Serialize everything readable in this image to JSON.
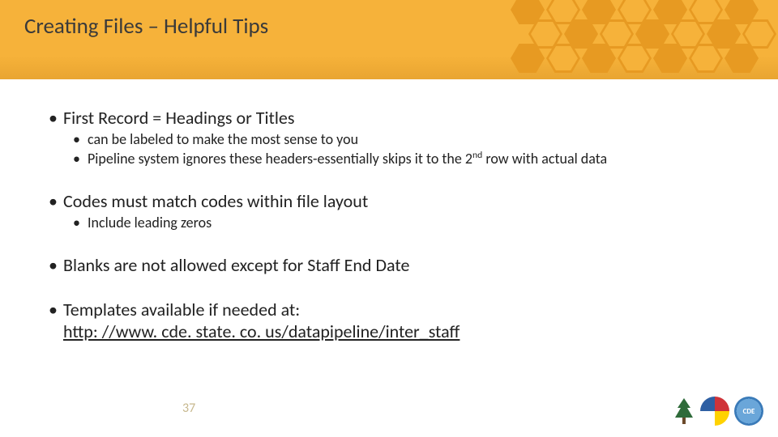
{
  "title": "Creating Files – Helpful Tips",
  "bullets": {
    "b1": "First Record = Headings or Titles",
    "b1a": "can be labeled to make the most sense to you",
    "b1b_pre": "Pipeline system ignores these headers-essentially skips it to the 2",
    "b1b_sup": "nd",
    "b1b_post": " row with actual data",
    "b2": "Codes must match codes within file layout",
    "b2a": "Include leading zeros",
    "b3": "Blanks are not allowed except for Staff End Date",
    "b4": "Templates available if needed at:",
    "b4_link": "http: //www. cde. state. co. us/datapipeline/inter_staff"
  },
  "page_number": "37",
  "logos": {
    "cde_text": "CDE"
  }
}
